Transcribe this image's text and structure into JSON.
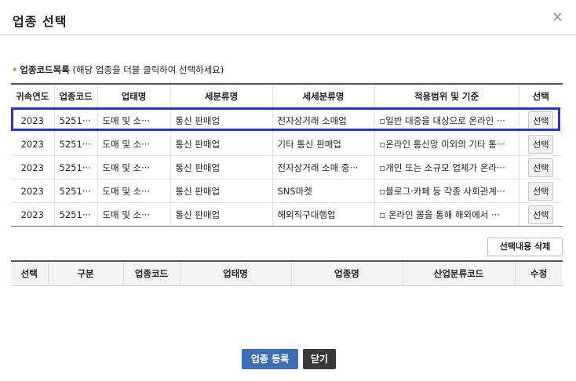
{
  "dialog": {
    "title": "업종 선택",
    "close_glyph": "✕"
  },
  "section": {
    "bullet": "•",
    "label": "업종코드목록",
    "hint": " (해당 업종을 더블 클릭하여 선택하세요)"
  },
  "list_table": {
    "headers": [
      "귀속연도",
      "업종코드",
      "업태명",
      "세분류명",
      "세세분류명",
      "적용범위 및 기준",
      "선택"
    ],
    "rows": [
      {
        "year": "2023",
        "code": "5251···",
        "type": "도매 및 소···",
        "sub": "통신 판매업",
        "subsub": "전자상거래 소매업",
        "scope": "▫일반 대중을 대상으로 온라인 ···",
        "select": "선택"
      },
      {
        "year": "2023",
        "code": "5251···",
        "type": "도매 및 소···",
        "sub": "통신 판매업",
        "subsub": "기타 통신 판매업",
        "scope": "▫온라인 통신망 이외의 기타 통···",
        "select": "선택"
      },
      {
        "year": "2023",
        "code": "5251···",
        "type": "도매 및 소···",
        "sub": "통신 판매업",
        "subsub": "전자상거래 소매 중···",
        "scope": "▫개인 또는 소규모 업체가 온라···",
        "select": "선택"
      },
      {
        "year": "2023",
        "code": "5251···",
        "type": "도매 및 소···",
        "sub": "통신 판매업",
        "subsub": "SNS마켓",
        "scope": "▫블로그·카페 등 각종 사회관계···",
        "select": "선택"
      },
      {
        "year": "2023",
        "code": "5251···",
        "type": "도매 및 소···",
        "sub": "통신 판매업",
        "subsub": "해외직구대행업",
        "scope": "▫ 온라인 몰을 통해 해외에서 ···",
        "select": "선택"
      }
    ]
  },
  "delete_button": "선택내용 삭제",
  "selected_table": {
    "headers": [
      "선택",
      "구분",
      "업종코드",
      "업태명",
      "업종명",
      "산업분류코드",
      "수정"
    ]
  },
  "footer": {
    "register": "업종 등록",
    "close": "닫기"
  },
  "colors": {
    "highlight": "#2b33c2",
    "register_bg": "#3d6fb6",
    "close_bg": "#3a3a3a",
    "bullet": "#e07a2e"
  }
}
